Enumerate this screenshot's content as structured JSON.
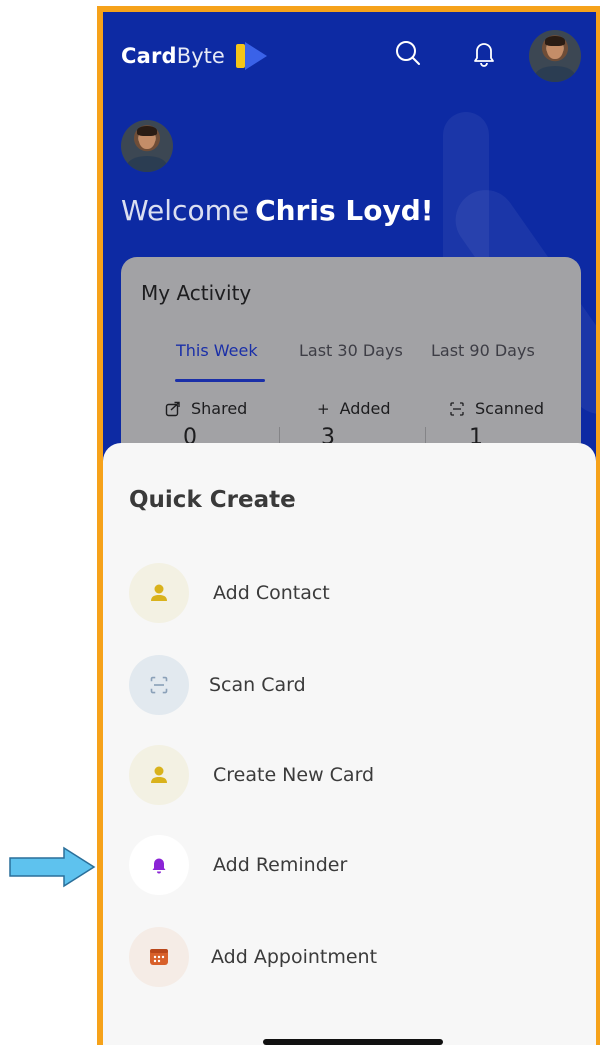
{
  "header": {
    "logo_bold": "Card",
    "logo_light": "Byte",
    "icons": [
      "search-icon",
      "bell-icon",
      "profile-avatar"
    ]
  },
  "welcome": {
    "greeting": "Welcome",
    "name": "Chris Loyd!"
  },
  "activity": {
    "title": "My Activity",
    "tabs": [
      {
        "label": "This Week",
        "active": true
      },
      {
        "label": "Last 30 Days",
        "active": false
      },
      {
        "label": "Last 90 Days",
        "active": false
      }
    ],
    "stats": [
      {
        "label": "Shared",
        "icon": "share-icon",
        "value": "0"
      },
      {
        "label": "Added",
        "icon": "plus-icon",
        "value": "3"
      },
      {
        "label": "Scanned",
        "icon": "scan-icon",
        "value": "1"
      }
    ]
  },
  "quick_create": {
    "title": "Quick Create",
    "items": [
      {
        "label": "Add Contact",
        "icon": "person-icon",
        "bg": "#f3f1e3",
        "color": "#d9b21c"
      },
      {
        "label": "Scan Card",
        "icon": "scan-icon",
        "bg": "#e2e9ef",
        "color": "#8aa0b8"
      },
      {
        "label": "Create New Card",
        "icon": "person-icon",
        "bg": "#f3f1e3",
        "color": "#d9b21c"
      },
      {
        "label": "Add Reminder",
        "icon": "bell-icon",
        "bg": "#ffffff",
        "color": "#8b24d6"
      },
      {
        "label": "Add Appointment",
        "icon": "calendar-icon",
        "bg": "#f5ece6",
        "color": "#d8602a"
      }
    ]
  },
  "colors": {
    "brand_blue": "#0d2aa3",
    "frame_orange": "#f6a21a",
    "arrow_blue": "#5ec2ee",
    "logo_yellow": "#f5c518",
    "logo_blue": "#3a62e8"
  }
}
